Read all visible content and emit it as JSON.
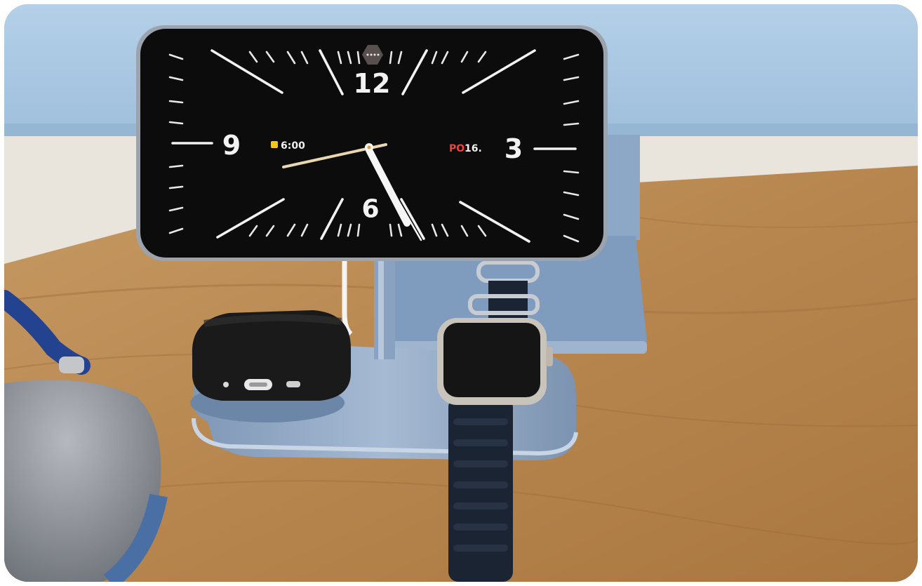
{
  "clock_display": {
    "numerals": {
      "twelve": "12",
      "three": "3",
      "six": "6",
      "nine": "9"
    },
    "alarm_time": "6:00",
    "day_label": "PO",
    "date_number": "16."
  },
  "colors": {
    "monitor_blue": "#a9c8e2",
    "desk_wood": "#b98a56",
    "stand_metal": "#8ea6c4",
    "screen_black": "#0c0c0c",
    "watch_band": "#1b2433",
    "earbuds_case": "#1a1a1a",
    "headphones": "#8f949b",
    "date_red": "#ff3b3b"
  }
}
